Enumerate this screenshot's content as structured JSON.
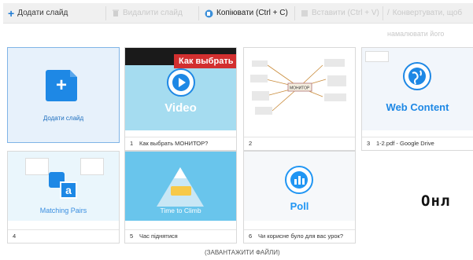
{
  "toolbar": {
    "add_slide": "Додати слайд",
    "delete_slide": "Видалити слайд",
    "copy": "Копіювати (Ctrl + C)",
    "paste": "Вставити (Ctrl + V)",
    "convert": "Конвертувати, щоб",
    "convert_sub": "намалювати його"
  },
  "add_tile": {
    "label": "Додати слайд"
  },
  "slides": [
    {
      "num": "1",
      "caption": "Как выбрать МОНИТОР?",
      "title": "Video",
      "banner": "Как выбрать"
    },
    {
      "num": "2",
      "caption": "",
      "center": "МОНИТОР"
    },
    {
      "num": "3",
      "caption": "1-2.pdf - Google Drive",
      "title": "Web Content"
    },
    {
      "num": "4",
      "caption": "",
      "title": "Matching Pairs"
    },
    {
      "num": "5",
      "caption": "Час піднятися",
      "title": "Time to Climb"
    },
    {
      "num": "6",
      "caption": "Чи корисне було для вас урок?",
      "title": "Poll"
    }
  ],
  "side_text": "Онл",
  "upload_label": "(ЗАВАНТАЖИТИ ФАЙЛИ)",
  "colors": {
    "accent": "#1e88e5",
    "video_bg": "#a5dcf0",
    "webcontent": "#1e88e5",
    "poll": "#2196f3",
    "tiles_bg": "#eaf6fc"
  }
}
